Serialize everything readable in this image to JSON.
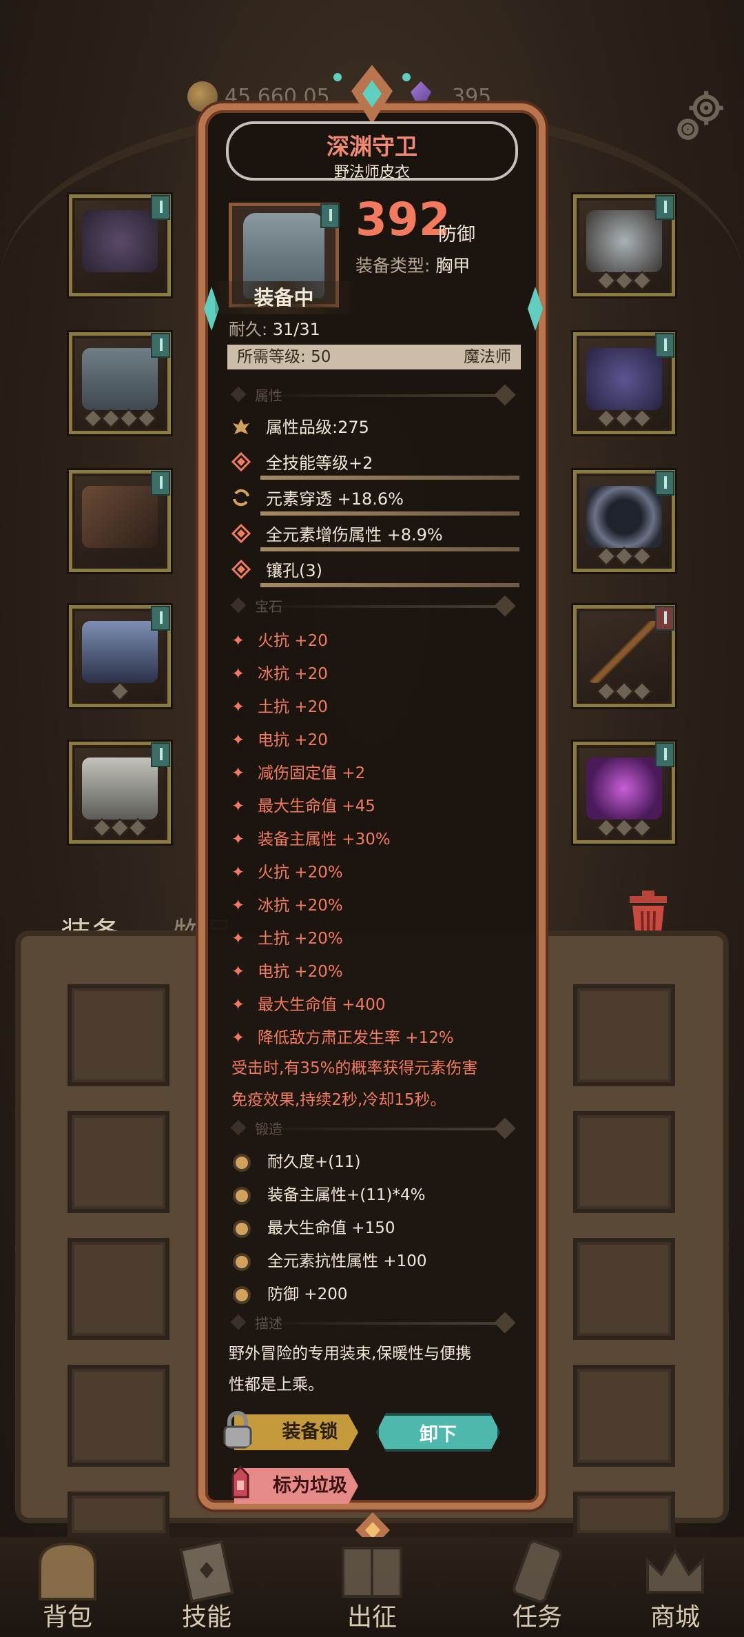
{
  "currency": {
    "gold": "45,660,05",
    "gems": "395"
  },
  "tabs": {
    "equipment": "装备",
    "items": "物品"
  },
  "tooltip": {
    "title": "深渊守卫",
    "subtitle": "野法师皮衣",
    "value": "392",
    "value_unit": "防御",
    "type_label": "装备类型:",
    "type_value": "胸甲",
    "equipped": "装备中",
    "durability_label": "耐久:",
    "durability_value": "31/31",
    "level_label": "所需等级:",
    "level_value": "50",
    "class": "魔法师",
    "sections": {
      "attributes": "属性",
      "gems": "宝石",
      "forge": "锻造",
      "description": "描述"
    },
    "attributes": [
      {
        "text": "属性品级:",
        "value": "275",
        "icon": "attribute-grade-icon"
      },
      {
        "text": "全技能等级+2",
        "icon": "skill-diamond-icon"
      },
      {
        "text": "元素穿透 +18.6%",
        "icon": "element-penetration-icon"
      },
      {
        "text": "全元素增伤属性 +8.9%",
        "icon": "element-damage-icon"
      },
      {
        "text": "镶孔(3)",
        "icon": "socket-icon"
      }
    ],
    "gems": [
      "火抗 +20",
      "冰抗 +20",
      "土抗 +20",
      "电抗 +20",
      "减伤固定值 +2",
      "最大生命值 +45",
      "装备主属性 +30%",
      "火抗 +20%",
      "冰抗 +20%",
      "土抗 +20%",
      "电抗 +20%",
      "最大生命值 +400",
      "降低敌方肃正发生率 +12%"
    ],
    "effect_line1": "受击时,有35%的概率获得元素伤害",
    "effect_line2": "免疫效果,持续2秒,冷却15秒。",
    "forge": [
      "耐久度+(11)",
      "装备主属性+(11)*4%",
      "最大生命值 +150",
      "全元素抗性属性 +100",
      "防御 +200"
    ],
    "description_line1": "野外冒险的专用装束,保暖性与便携",
    "description_line2": "性都是上乘。",
    "buttons": {
      "lock": "装备锁",
      "unequip": "卸下",
      "junk": "标为垃圾"
    }
  },
  "nav": [
    {
      "label": "背包",
      "icon": "backpack-icon"
    },
    {
      "label": "技能",
      "icon": "skills-book-icon"
    },
    {
      "label": "出征",
      "icon": "map-scroll-icon"
    },
    {
      "label": "任务",
      "icon": "quest-scroll-icon"
    },
    {
      "label": "商城",
      "icon": "shop-crown-icon"
    }
  ],
  "colors": {
    "accent_red": "#f27b5f",
    "teal": "#4fb8ad",
    "gold": "#c49a3c",
    "pink": "#e68a88"
  }
}
